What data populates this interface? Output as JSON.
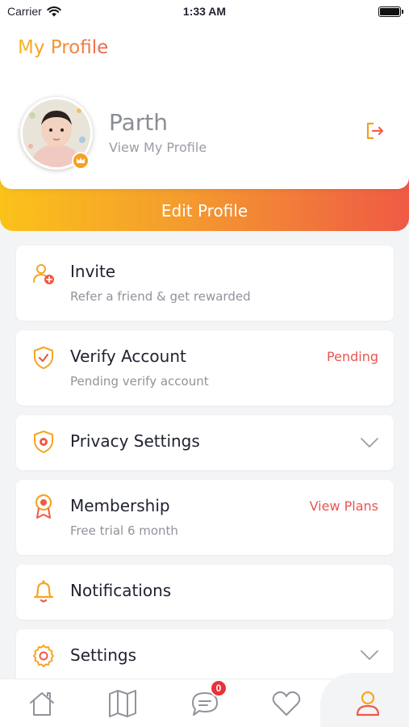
{
  "status_bar": {
    "carrier": "Carrier",
    "time": "1:33 AM"
  },
  "header": {
    "title": "My Profile",
    "user_name": "Parth",
    "user_subtitle": "View My Profile"
  },
  "edit_profile": {
    "label": "Edit Profile"
  },
  "menu": {
    "invite": {
      "label": "Invite",
      "subtitle": "Refer a friend & get rewarded",
      "icon": "add-user-icon"
    },
    "verify": {
      "label": "Verify Account",
      "subtitle": "Pending verify account",
      "status": "Pending",
      "icon": "shield-check-icon"
    },
    "privacy": {
      "label": "Privacy Settings",
      "icon": "shield-gear-icon"
    },
    "membership": {
      "label": "Membership",
      "subtitle": "Free trial 6 month",
      "action": "View Plans",
      "icon": "medal-icon"
    },
    "notifications": {
      "label": "Notifications",
      "icon": "bell-icon"
    },
    "settings": {
      "label": "Settings",
      "icon": "gear-icon"
    }
  },
  "tab_bar": {
    "items": [
      "home",
      "map",
      "chat",
      "favorites",
      "profile"
    ],
    "chat_badge": "0",
    "active": "profile"
  },
  "colors": {
    "accent_start": "#fbc21a",
    "accent_end": "#ef5a45",
    "danger": "#e85452",
    "icon_orange": "#f5a623"
  }
}
